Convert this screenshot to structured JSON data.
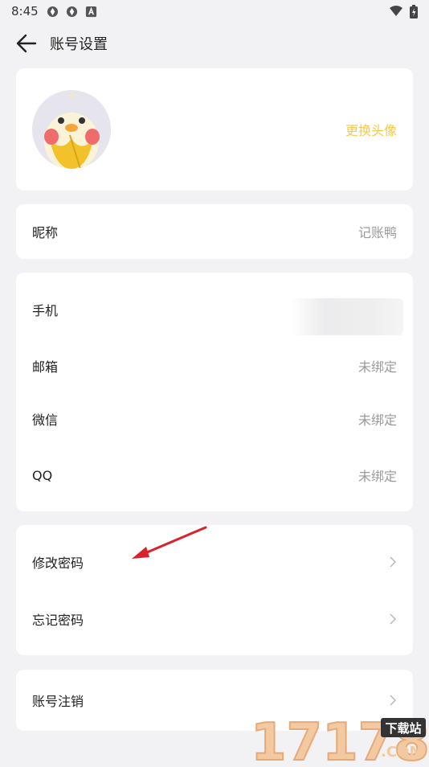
{
  "status_bar": {
    "time": "8:45",
    "icons": [
      "app-notification-icon",
      "app-notification-icon",
      "a-letter-icon",
      "wifi-icon",
      "battery-icon"
    ]
  },
  "header": {
    "title": "账号设置",
    "back_icon": "arrow-left-icon"
  },
  "avatar_card": {
    "change_avatar_label": "更换头像"
  },
  "nickname": {
    "label": "昵称",
    "value": "记账鸭"
  },
  "bindings": [
    {
      "label": "手机",
      "value": ""
    },
    {
      "label": "邮箱",
      "value": "未绑定"
    },
    {
      "label": "微信",
      "value": "未绑定"
    },
    {
      "label": "QQ",
      "value": "未绑定"
    }
  ],
  "password": [
    {
      "label": "修改密码"
    },
    {
      "label": "忘记密码"
    }
  ],
  "account": {
    "cancel_label": "账号注销"
  },
  "watermark": {
    "text": "17178",
    "badge": "下载站",
    "suffix": ".COM"
  },
  "colors": {
    "accent": "#f6c94a",
    "muted": "#9a9a9a",
    "background": "#f2f2f4",
    "arrow_annotation": "#d9222a"
  }
}
